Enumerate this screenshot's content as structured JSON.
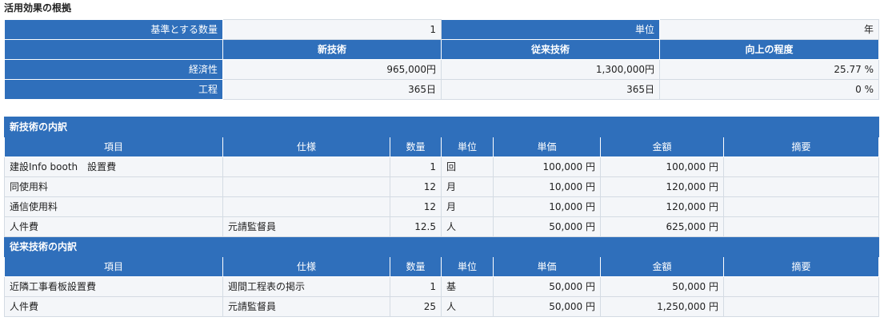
{
  "title": "活用効果の根拠",
  "summary": {
    "basis_label": "基準とする数量",
    "basis_value": "1",
    "unit_label": "単位",
    "unit_value": "年",
    "headers": [
      "新技術",
      "従来技術",
      "向上の程度"
    ],
    "rows": [
      {
        "label": "経済性",
        "new": "965,000円",
        "old": "1,300,000円",
        "improvement": "25.77 %"
      },
      {
        "label": "工程",
        "new": "365日",
        "old": "365日",
        "improvement": "0 %"
      }
    ]
  },
  "new_tech": {
    "section_title": "新技術の内訳",
    "rows": [
      {
        "item": "建設Info booth　設置費",
        "spec": "",
        "qty": "1",
        "unit": "回",
        "unit_price": "100,000 円",
        "amount": "100,000 円",
        "note": ""
      },
      {
        "item": "同使用料",
        "spec": "",
        "qty": "12",
        "unit": "月",
        "unit_price": "10,000 円",
        "amount": "120,000 円",
        "note": ""
      },
      {
        "item": "通信使用料",
        "spec": "",
        "qty": "12",
        "unit": "月",
        "unit_price": "10,000 円",
        "amount": "120,000 円",
        "note": ""
      },
      {
        "item": "人件費",
        "spec": "元請監督員",
        "qty": "12.5",
        "unit": "人",
        "unit_price": "50,000 円",
        "amount": "625,000 円",
        "note": ""
      }
    ]
  },
  "old_tech": {
    "section_title": "従来技術の内訳",
    "rows": [
      {
        "item": "近隣工事看板設置費",
        "spec": "週間工程表の掲示",
        "qty": "1",
        "unit": "基",
        "unit_price": "50,000 円",
        "amount": "50,000 円",
        "note": ""
      },
      {
        "item": "人件費",
        "spec": "元請監督員",
        "qty": "25",
        "unit": "人",
        "unit_price": "50,000 円",
        "amount": "1,250,000 円",
        "note": ""
      }
    ]
  },
  "columns": [
    "項目",
    "仕様",
    "数量",
    "単位",
    "単価",
    "金額",
    "摘要"
  ]
}
